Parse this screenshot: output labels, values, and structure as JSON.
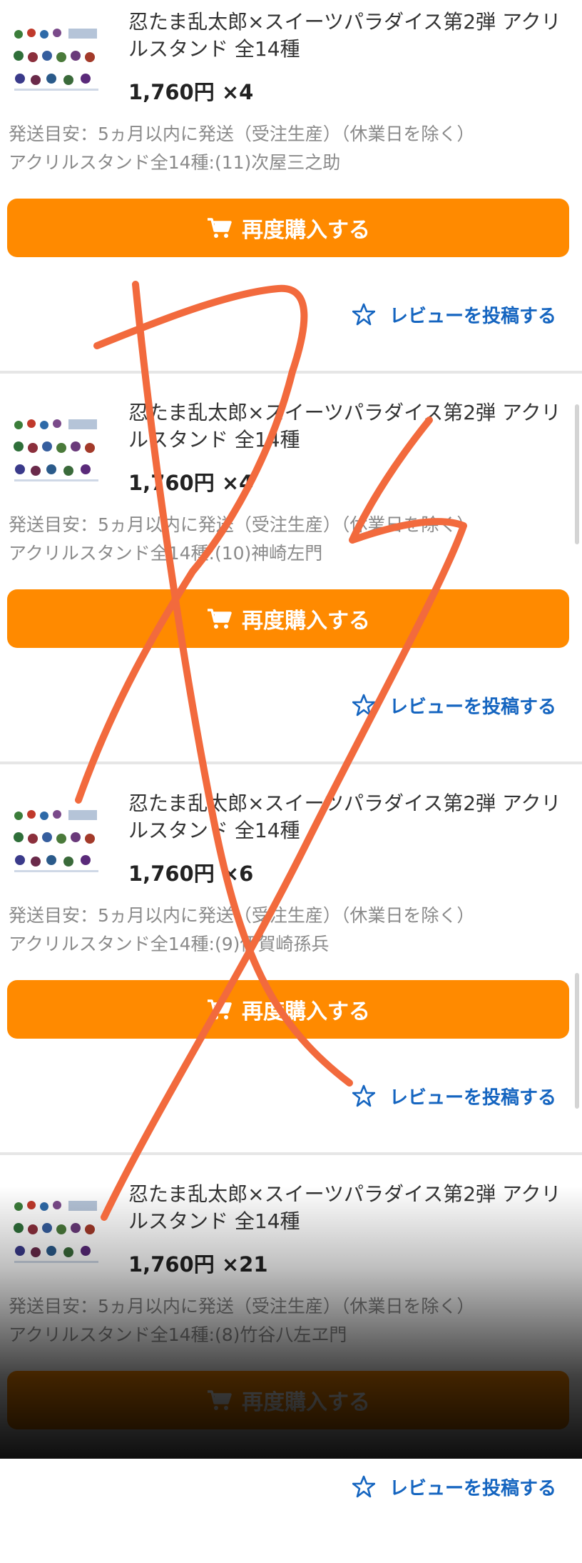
{
  "orders": [
    {
      "title": "忍たま乱太郎×スイーツパラダイス第2弾 アクリルスタンド 全14種",
      "price": "1,760円",
      "quantity": "×4",
      "shipping": "発送目安：5ヵ月以内に発送（受注生産）（休業日を除く）",
      "variant": "アクリルスタンド全14種:(11)次屋三之助",
      "rebuy_label": "再度購入する",
      "review_label": "レビューを投稿する"
    },
    {
      "title": "忍たま乱太郎×スイーツパラダイス第2弾 アクリルスタンド 全14種",
      "price": "1,760円",
      "quantity": "×4",
      "shipping": "発送目安：5ヵ月以内に発送（受注生産）（休業日を除く）",
      "variant": "アクリルスタンド全14種:(10)神崎左門",
      "rebuy_label": "再度購入する",
      "review_label": "レビューを投稿する"
    },
    {
      "title": "忍たま乱太郎×スイーツパラダイス第2弾 アクリルスタンド 全14種",
      "price": "1,760円",
      "quantity": "×6",
      "shipping": "発送目安：5ヵ月以内に発送（受注生産）（休業日を除く）",
      "variant": "アクリルスタンド全14種:(9)伊賀崎孫兵",
      "rebuy_label": "再度購入する",
      "review_label": "レビューを投稿する"
    },
    {
      "title": "忍たま乱太郎×スイーツパラダイス第2弾 アクリルスタンド 全14種",
      "price": "1,760円",
      "quantity": "×21",
      "shipping": "発送目安：5ヵ月以内に発送（受注生産）（休業日を除く）",
      "variant": "アクリルスタンド全14種:(8)竹谷八左ヱ門",
      "rebuy_label": "再度購入する",
      "review_label": "レビューを投稿する"
    }
  ],
  "icons": {
    "cart": "cart-icon",
    "review": "star-outline-icon",
    "thumbnail": "product-thumbnail"
  },
  "colors": {
    "button": "#ff8a00",
    "link": "#1565c0",
    "scribble": "#f26a3d",
    "text_secondary": "#8a8a8a"
  }
}
